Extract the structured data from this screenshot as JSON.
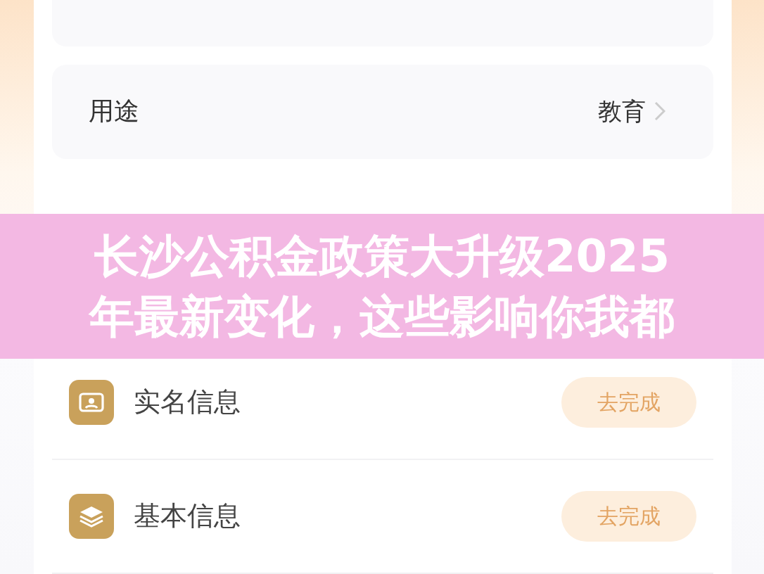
{
  "detail_rows": [
    {
      "label": "用途",
      "value": "教育"
    }
  ],
  "verification_items": [
    {
      "label": "实名信息",
      "action": "去完成"
    },
    {
      "label": "基本信息",
      "action": "去完成"
    }
  ],
  "banner": {
    "lines": [
      "长沙公积金政策大升级2025",
      "年最新变化，这些影响你我都"
    ]
  }
}
